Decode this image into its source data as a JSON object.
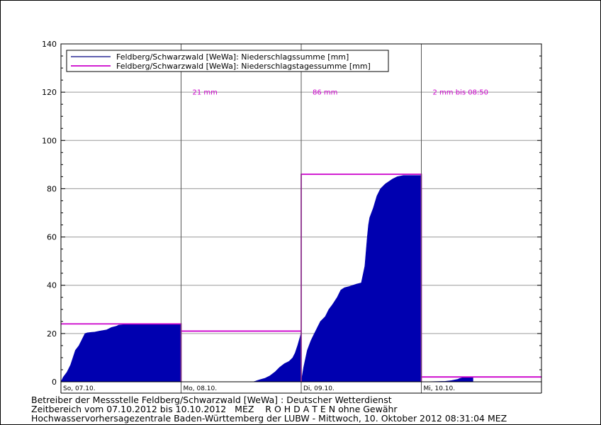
{
  "chart_data": {
    "type": "area",
    "title": "",
    "xlabel": "",
    "ylabel": "",
    "ylim": [
      0,
      140
    ],
    "yticks": [
      0,
      20,
      40,
      60,
      80,
      100,
      120,
      140
    ],
    "grid": true,
    "legend_position": "top-left",
    "legend": [
      {
        "label": "Feldberg/Schwarzwald [WeWa]: Niederschlagssumme [mm]",
        "color": "#000080"
      },
      {
        "label": "Feldberg/Schwarzwald [WeWa]: Niederschlagstagessumme [mm]",
        "color": "#cc00cc"
      }
    ],
    "days": [
      "So, 07.10.",
      "Mo, 08.10.",
      "Di, 09.10.",
      "Mi, 10.10."
    ],
    "annotations": [
      {
        "day_index": 1,
        "text": "21 mm"
      },
      {
        "day_index": 2,
        "text": "86 mm"
      },
      {
        "day_index": 3,
        "text": "2 mm bis 08:50"
      }
    ],
    "series": [
      {
        "name": "Feldberg/Schwarzwald [WeWa]: Niederschlagssumme [mm]",
        "color": "#0000b0",
        "x": [
          0,
          0.02,
          0.05,
          0.08,
          0.1,
          0.12,
          0.15,
          0.18,
          0.2,
          0.22,
          0.25,
          0.28,
          0.32,
          0.38,
          0.42,
          0.46,
          0.48,
          0.52,
          0.56,
          0.6,
          0.7,
          0.8,
          0.9,
          1.0,
          1.0,
          1.6,
          1.62,
          1.65,
          1.7,
          1.74,
          1.78,
          1.82,
          1.86,
          1.9,
          1.93,
          1.95,
          1.97,
          1.99,
          2.0,
          2.0,
          2.02,
          2.05,
          2.08,
          2.1,
          2.13,
          2.16,
          2.2,
          2.23,
          2.26,
          2.3,
          2.33,
          2.36,
          2.4,
          2.43,
          2.46,
          2.5,
          2.53,
          2.55,
          2.56,
          2.57,
          2.6,
          2.63,
          2.66,
          2.7,
          2.73,
          2.76,
          2.8,
          2.85,
          2.9,
          2.95,
          3.0,
          3.0,
          3.2,
          3.25,
          3.3,
          3.32,
          3.35,
          3.4,
          3.43
        ],
        "y": [
          0,
          2,
          4,
          7,
          10,
          13,
          15,
          18,
          20,
          20.3,
          20.5,
          20.6,
          21,
          21.5,
          22.5,
          23,
          23.5,
          23.7,
          23.8,
          24,
          24,
          24,
          24,
          24,
          0,
          0,
          0.3,
          0.8,
          1.5,
          2.5,
          4,
          6,
          7.5,
          8.5,
          10,
          12,
          15,
          18.5,
          20.5,
          0,
          6,
          13,
          17,
          19,
          22,
          25,
          27,
          30,
          32,
          35,
          38,
          39,
          39.5,
          40,
          40.5,
          41,
          48,
          60,
          65,
          68,
          72,
          77,
          80,
          82,
          83,
          84,
          85,
          85.5,
          85.5,
          85.5,
          85.5,
          0,
          0.2,
          0.5,
          1.0,
          1.4,
          1.8,
          2,
          2
        ]
      },
      {
        "name": "Feldberg/Schwarzwald [WeWa]: Niederschlagstagessumme [mm]",
        "color": "#cc00cc",
        "values": [
          24,
          21,
          86,
          2
        ]
      }
    ]
  },
  "footer": {
    "line1": "Betreiber der Messstelle Feldberg/Schwarzwald [WeWa] : Deutscher Wetterdienst",
    "line2": "Zeitbereich vom 07.10.2012 bis 10.10.2012   MEZ    R O H D A T E N ohne Gewähr",
    "line3": "Hochwasservorhersagezentrale Baden-Württemberg der LUBW - Mittwoch, 10. Oktober 2012 08:31:04 MEZ"
  }
}
